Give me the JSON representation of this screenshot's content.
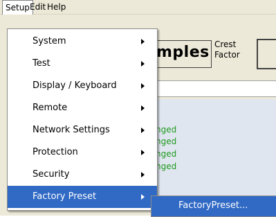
{
  "menubar": {
    "items": [
      {
        "label": "Setup"
      },
      {
        "label": "Edit"
      },
      {
        "label": "Help"
      }
    ]
  },
  "background": {
    "samples_text": "mples",
    "crest_label_line1": "Crest",
    "crest_label_line2": "Factor",
    "status_lines": [
      "nged",
      "nged",
      "nged",
      "nged"
    ]
  },
  "setup_menu": {
    "items": [
      {
        "label": "System"
      },
      {
        "label": "Test"
      },
      {
        "label": "Display / Keyboard"
      },
      {
        "label": "Remote"
      },
      {
        "label": "Network Settings"
      },
      {
        "label": "Protection"
      },
      {
        "label": "Security"
      },
      {
        "label": "Factory Preset"
      }
    ],
    "highlighted": "Factory Preset"
  },
  "submenu": {
    "item": "FactoryPreset..."
  },
  "colors": {
    "menu_highlight": "#316ac5",
    "status_text": "#1e9a1e",
    "chrome": "#ece9d8"
  }
}
